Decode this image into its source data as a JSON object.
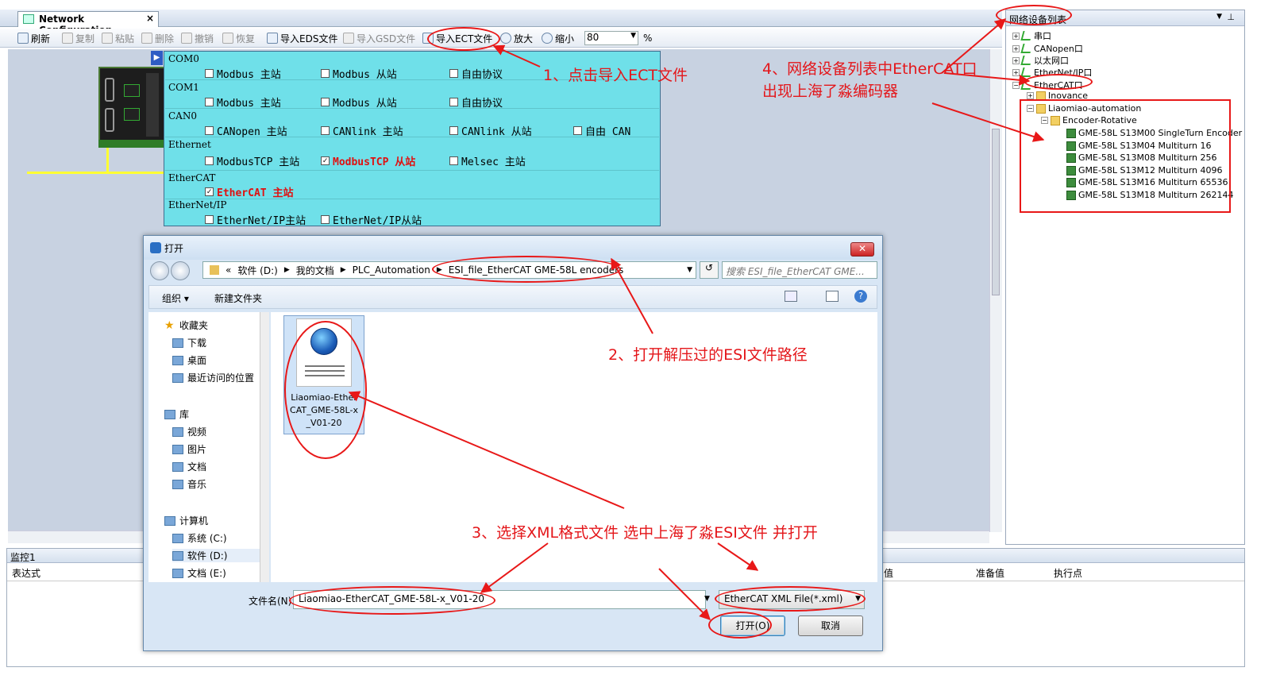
{
  "doc_tab": {
    "title": "Network Configuration",
    "close": "×"
  },
  "toolbar": {
    "refresh": "刷新",
    "copy": "复制",
    "paste": "粘贴",
    "delete": "删除",
    "undo": "撤销",
    "redo": "恢复",
    "import_eds": "导入EDS文件",
    "import_gsd": "导入GSD文件",
    "import_ect": "导入ECT文件",
    "zoom_in": "放大",
    "zoom_out": "缩小",
    "zoom_value": "80",
    "zoom_unit": "%"
  },
  "config": {
    "groups": [
      {
        "title": "COM0",
        "options": [
          {
            "label": "Modbus 主站",
            "checked": false
          },
          {
            "label": "Modbus 从站",
            "checked": false
          },
          {
            "label": "自由协议",
            "checked": false
          }
        ]
      },
      {
        "title": "COM1",
        "options": [
          {
            "label": "Modbus 主站",
            "checked": false
          },
          {
            "label": "Modbus 从站",
            "checked": false
          },
          {
            "label": "自由协议",
            "checked": false
          }
        ]
      },
      {
        "title": "CAN0",
        "options": [
          {
            "label": "CANopen 主站",
            "checked": false
          },
          {
            "label": "CANlink 主站",
            "checked": false
          },
          {
            "label": "CANlink 从站",
            "checked": false
          },
          {
            "label": "自由 CAN",
            "checked": false
          }
        ]
      },
      {
        "title": "Ethernet",
        "options": [
          {
            "label": "ModbusTCP 主站",
            "checked": false
          },
          {
            "label": "ModbusTCP 从站",
            "checked": true
          },
          {
            "label": "Melsec 主站",
            "checked": false
          }
        ]
      },
      {
        "title": "EtherCAT",
        "options": [
          {
            "label": "EtherCAT 主站",
            "checked": true
          }
        ]
      },
      {
        "title": "EtherNet/IP",
        "options": [
          {
            "label": "EtherNet/IP主站",
            "checked": false
          },
          {
            "label": "EtherNet/IP从站",
            "checked": false
          }
        ]
      }
    ],
    "check_mark": "✓"
  },
  "right_panel": {
    "title": "网络设备列表",
    "tree": [
      "串口",
      "CANopen口",
      "以太网口",
      "EtherNet/IP口",
      "EtherCAT口",
      "Inovance",
      "Liaomiao-automation",
      "Encoder-Rotative"
    ],
    "devices": [
      "GME-58L S13M00 SingleTurn Encoder",
      "GME-58L S13M04 Multiturn 16",
      "GME-58L S13M08 Multiturn 256",
      "GME-58L S13M12 Multiturn 4096",
      "GME-58L S13M16 Multiturn 65536",
      "GME-58L S13M18 Multiturn 262144"
    ]
  },
  "monitor": {
    "title": "监控1",
    "columns": [
      "表达式",
      "值",
      "准备值",
      "执行点"
    ]
  },
  "dialog": {
    "title": "打开",
    "breadcrumb": [
      "«",
      "软件 (D:)",
      "我的文档",
      "PLC_Automation",
      "ESI_file_EtherCAT GME-58L encoders"
    ],
    "search_placeholder": "搜索 ESI_file_EtherCAT GME...",
    "organize": "组织 ▾",
    "new_folder": "新建文件夹",
    "sidebar": {
      "favorites": "收藏夹",
      "downloads": "下载",
      "desktop": "桌面",
      "recent": "最近访问的位置",
      "libraries": "库",
      "videos": "视频",
      "pictures": "图片",
      "documents": "文档",
      "music": "音乐",
      "computer": "计算机",
      "drive_c": "系统 (C:)",
      "drive_d": "软件 (D:)",
      "drive_e": "文档 (E:)"
    },
    "file": {
      "line1": "Liaomiao-Ether",
      "line2": "CAT_GME-58L-x",
      "line3": "_V01-20"
    },
    "filename_label": "文件名(N):",
    "filename_value": "Liaomiao-EtherCAT_GME-58L-x_V01-20",
    "filetype": "EtherCAT  XML  File(*.xml)",
    "open_button": "打开(O)",
    "cancel_button": "取消"
  },
  "annotations": {
    "step1": "1、点击导入ECT文件",
    "step2": "2、打开解压过的ESI文件路径",
    "step3": "3、选择XML格式文件 选中上海了淼ESI文件 并打开",
    "step4_line1": "4、网络设备列表中EtherCAT口",
    "step4_line2": "出现上海了淼编码器"
  }
}
